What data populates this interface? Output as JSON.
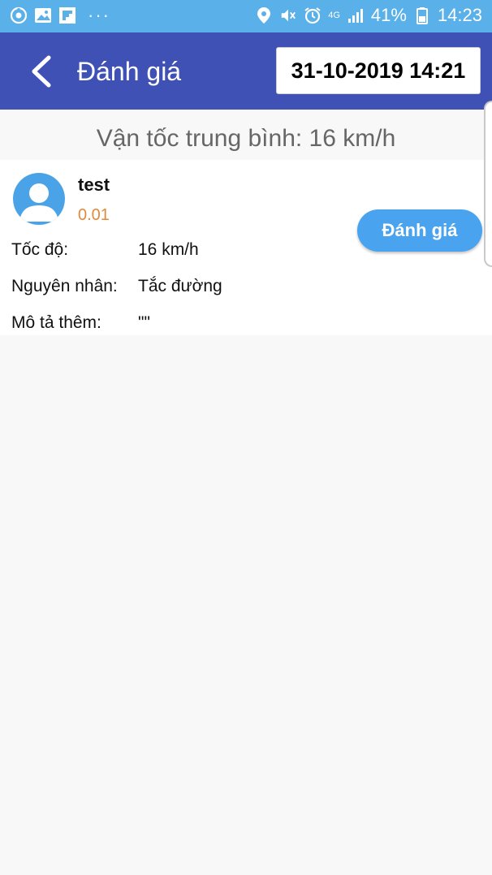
{
  "status_bar": {
    "signal_label": "4G",
    "battery_percent": "41%",
    "time": "14:23",
    "icons": [
      "sync-icon",
      "image-icon",
      "flipboard-icon",
      "more-icon",
      "location-icon",
      "mute-icon",
      "alarm-icon",
      "signal-icon",
      "battery-icon"
    ]
  },
  "header": {
    "title": "Đánh giá",
    "datetime": "31-10-2019 14:21",
    "color": "#3f51b5"
  },
  "average_speed": "Vận tốc trung bình: 16 km/h",
  "review": {
    "username": "test",
    "score": "0.01",
    "rate_button": "Đánh giá",
    "fields": [
      {
        "label": "Tốc độ:",
        "value": "16 km/h"
      },
      {
        "label": "Nguyên nhân:",
        "value": "Tắc đường"
      },
      {
        "label": "Mô tả thêm:",
        "value": "\"\""
      }
    ]
  },
  "colors": {
    "status_bar": "#5ab0e9",
    "accent": "#4aa3ef",
    "score": "#e08a3c"
  }
}
